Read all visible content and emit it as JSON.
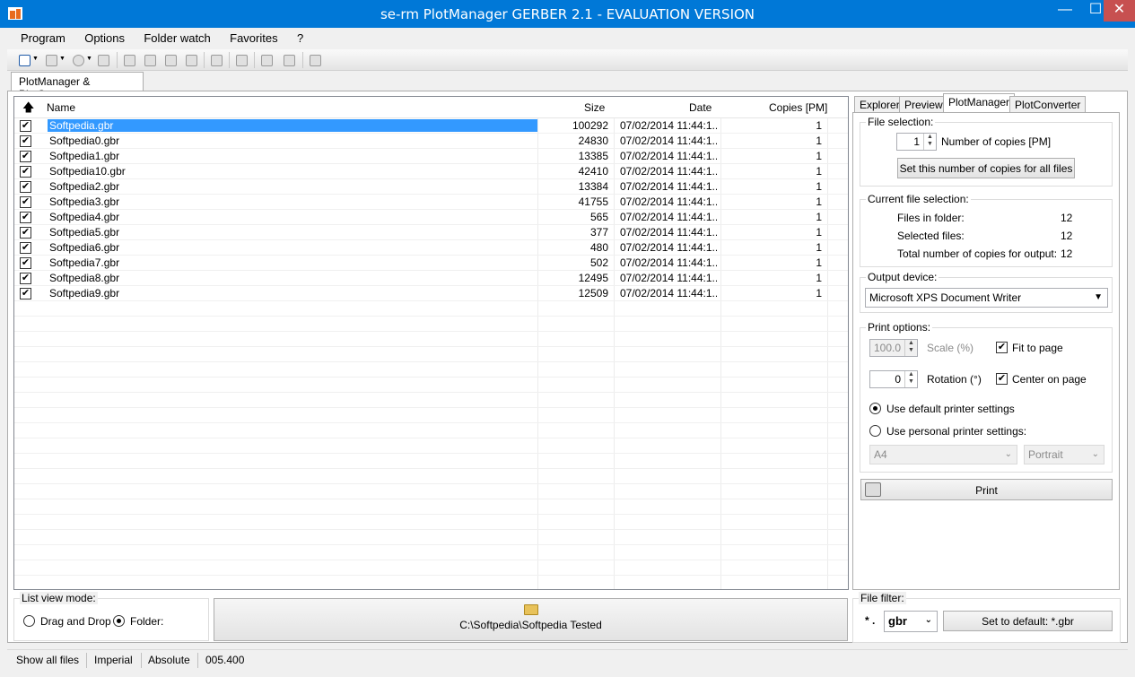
{
  "window": {
    "title": "se-rm PlotManager GERBER 2.1 - EVALUATION VERSION",
    "minimize": "—",
    "maximize": "☐",
    "close": "✕"
  },
  "menu": [
    "Program",
    "Options",
    "Folder watch",
    "Favorites",
    "?"
  ],
  "main_tab": "PlotManager & PlotConverter",
  "grid": {
    "columns": {
      "sort": "🡅",
      "name": "Name",
      "size": "Size",
      "date": "Date",
      "copies": "Copies [PM]"
    },
    "rows": [
      {
        "checked": "✔",
        "name": "Softpedia.gbr",
        "size": "100292",
        "date": "07/02/2014 11:44:1...",
        "copies": "1"
      },
      {
        "checked": "✔",
        "name": "Softpedia0.gbr",
        "size": "24830",
        "date": "07/02/2014 11:44:1...",
        "copies": "1"
      },
      {
        "checked": "✔",
        "name": "Softpedia1.gbr",
        "size": "13385",
        "date": "07/02/2014 11:44:1...",
        "copies": "1"
      },
      {
        "checked": "✔",
        "name": "Softpedia10.gbr",
        "size": "42410",
        "date": "07/02/2014 11:44:1...",
        "copies": "1"
      },
      {
        "checked": "✔",
        "name": "Softpedia2.gbr",
        "size": "13384",
        "date": "07/02/2014 11:44:1...",
        "copies": "1"
      },
      {
        "checked": "✔",
        "name": "Softpedia3.gbr",
        "size": "41755",
        "date": "07/02/2014 11:44:1...",
        "copies": "1"
      },
      {
        "checked": "✔",
        "name": "Softpedia4.gbr",
        "size": "565",
        "date": "07/02/2014 11:44:1...",
        "copies": "1"
      },
      {
        "checked": "✔",
        "name": "Softpedia5.gbr",
        "size": "377",
        "date": "07/02/2014 11:44:1...",
        "copies": "1"
      },
      {
        "checked": "✔",
        "name": "Softpedia6.gbr",
        "size": "480",
        "date": "07/02/2014 11:44:1...",
        "copies": "1"
      },
      {
        "checked": "✔",
        "name": "Softpedia7.gbr",
        "size": "502",
        "date": "07/02/2014 11:44:1...",
        "copies": "1"
      },
      {
        "checked": "✔",
        "name": "Softpedia8.gbr",
        "size": "12495",
        "date": "07/02/2014 11:44:1...",
        "copies": "1"
      },
      {
        "checked": "✔",
        "name": "Softpedia9.gbr",
        "size": "12509",
        "date": "07/02/2014 11:44:1...",
        "copies": "1"
      }
    ]
  },
  "right_tabs": [
    "Explorer",
    "Preview",
    "PlotManager",
    "PlotConverter"
  ],
  "file_selection": {
    "label": "File selection:",
    "copies": "1",
    "copies_label": "Number of copies [PM]",
    "set_all_button": "Set this number of copies for all files"
  },
  "current_selection": {
    "label": "Current file selection:",
    "files_in_folder_label": "Files in folder:",
    "files_in_folder": "12",
    "selected_label": "Selected files:",
    "selected": "12",
    "total_label": "Total number of copies for output:",
    "total": "12"
  },
  "output_device": {
    "label": "Output device:",
    "value": "Microsoft XPS Document Writer"
  },
  "print_options": {
    "label": "Print options:",
    "scale": "100.0",
    "scale_label": "Scale (%)",
    "fit_label": "Fit to page",
    "fit_checked": "✔",
    "rotation": "0",
    "rotation_label": "Rotation (°)",
    "center_label": "Center on page",
    "center_checked": "✔",
    "default_label": "Use default printer settings",
    "personal_label": "Use personal printer settings:",
    "paper": "A4",
    "orientation": "Portrait"
  },
  "print_button": "Print",
  "list_view": {
    "label": "List view mode:",
    "drag_label": "Drag and Drop",
    "folder_label": "Folder:"
  },
  "folder_path": "C:\\Softpedia\\Softpedia Tested",
  "file_filter": {
    "label": "File filter:",
    "prefix": "* .",
    "value": "gbr",
    "default_button": "Set to default: *.gbr"
  },
  "status": [
    "Show all files",
    "Imperial",
    "Absolute",
    "005.400"
  ],
  "colors": {
    "titlebar": "#0078d7",
    "selection": "#3399ff"
  }
}
